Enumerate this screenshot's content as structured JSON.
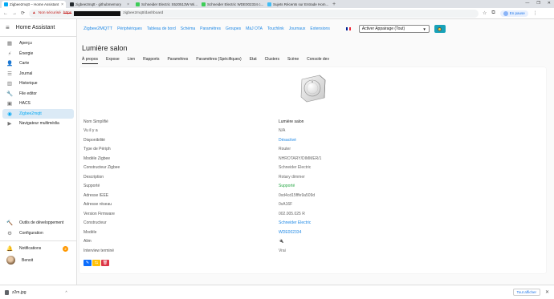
{
  "browser": {
    "tabs": [
      {
        "label": "Zigbee2mqtt – Home Assistant",
        "color": "#03a9f4"
      },
      {
        "label": "zigbee2mqtt - githubmemory",
        "color": "#24292e"
      },
      {
        "label": "Schneider Electric S520513W Wi...",
        "color": "#3dcd58"
      },
      {
        "label": "Schneider Electric WDE002334 c...",
        "color": "#3dcd58"
      },
      {
        "label": "Sujets Récents sur Entrade Hom...",
        "color": "#41bdf5"
      }
    ],
    "new_tab": "+",
    "win_controls": [
      "—",
      "❐",
      "✕"
    ],
    "address": {
      "warning": "▲",
      "not_secure": "Non sécurisé",
      "proto": "https",
      "path": "zigbee2mqtt/dashboard"
    },
    "paused_label": "En pause"
  },
  "sidebar": {
    "title": "Home Assistant",
    "items": [
      {
        "icon": "▦",
        "label": "Aperçu"
      },
      {
        "icon": "⚡",
        "label": "Énergie"
      },
      {
        "icon": "👤",
        "label": "Carte"
      },
      {
        "icon": "☰",
        "label": "Journal"
      },
      {
        "icon": "▥",
        "label": "Historique"
      },
      {
        "icon": "🔧",
        "label": "File editor"
      },
      {
        "icon": "▣",
        "label": "HACS"
      },
      {
        "icon": "◉",
        "label": "Zigbee2mqtt"
      },
      {
        "icon": "▶",
        "label": "Navigateur multimédia"
      }
    ],
    "bottom_items": [
      {
        "icon": "🔨",
        "label": "Outils de développement"
      },
      {
        "icon": "⚙",
        "label": "Configuration"
      }
    ],
    "notifications": {
      "icon": "🔔",
      "label": "Notifications",
      "badge": "2"
    },
    "user": {
      "label": "Benoit"
    }
  },
  "z2m_nav": {
    "brand": "Zigbee2MQTT",
    "links": [
      "Périphériques",
      "Tableau de bord",
      "Schéma",
      "Paramètres",
      "Groupes",
      "MàJ OTA",
      "Touchlink",
      "Journaux",
      "Extensions"
    ],
    "permit_join": "Activer Appairage (Tout)",
    "flag_colors": [
      "#002395",
      "#ffffff",
      "#ed2939"
    ]
  },
  "device": {
    "title": "Lumière salon",
    "tabs": [
      "À propos",
      "Expose",
      "Lien",
      "Rapports",
      "Paramètres",
      "Paramètres (Spécifiques)",
      "Etat",
      "Clusters",
      "Scène",
      "Console dev"
    ],
    "active_tab_index": 0,
    "properties": [
      {
        "key": "Nom Simplifié",
        "value": "Lumière salon",
        "style": "strong"
      },
      {
        "key": "Vu il y a",
        "value": "N/A",
        "style": ""
      },
      {
        "key": "Disponibilité",
        "value": "Désactivé",
        "style": "link"
      },
      {
        "key": "Type de Périph",
        "value": "Router",
        "style": ""
      },
      {
        "key": "Modèle Zigbee",
        "value": "NHROTARY/DIMMER/1",
        "style": ""
      },
      {
        "key": "Constructeur Zigbee",
        "value": "Schneider Electric",
        "style": ""
      },
      {
        "key": "Description",
        "value": "Rotary dimmer",
        "style": ""
      },
      {
        "key": "Supporté",
        "value": "Supporté",
        "style": "green"
      },
      {
        "key": "Adresse IEEE",
        "value": "0xd4cd15fffe9a509d",
        "style": ""
      },
      {
        "key": "Adresse réseau",
        "value": "0xA16F",
        "style": ""
      },
      {
        "key": "Version Firmware",
        "value": "002.005.025 R",
        "style": ""
      },
      {
        "key": "Constructeur",
        "value": "Schneider Electric",
        "style": "link"
      },
      {
        "key": "Modèle",
        "value": "WDE002334",
        "style": "link"
      },
      {
        "key": "Alim",
        "value": "🔌",
        "style": ""
      },
      {
        "key": "Interview terminé",
        "value": "Vrai",
        "style": ""
      }
    ],
    "actions": [
      {
        "icon": "✎",
        "color": "#0d6efd"
      },
      {
        "icon": "⇆",
        "color": "#ffc107"
      },
      {
        "icon": "🗑",
        "color": "#dc3545"
      }
    ]
  },
  "downloads": {
    "file": "z2m.jpg",
    "caret": "^",
    "show_all": "Tout afficher",
    "close": "✕"
  }
}
